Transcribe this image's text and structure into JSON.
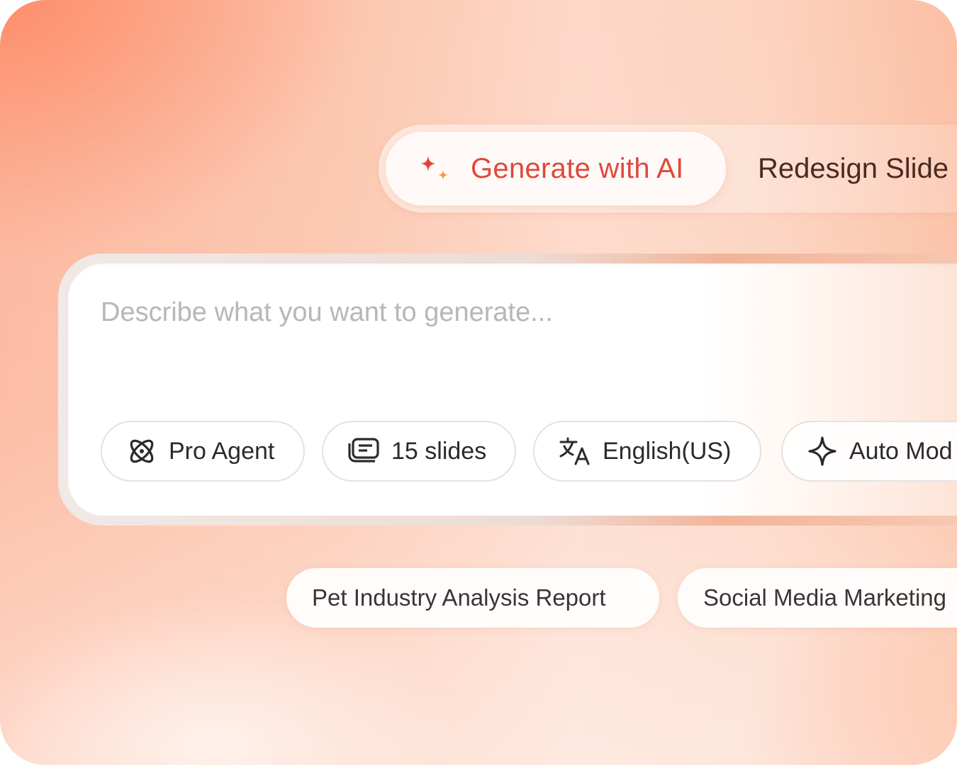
{
  "mode_switch": {
    "active_tab": {
      "label": "Generate with AI",
      "icon": "sparkle-icon",
      "color": "#e0483a"
    },
    "inactive_tab": {
      "label": "Redesign Slide"
    }
  },
  "prompt": {
    "placeholder": "Describe what you want to generate...",
    "value": ""
  },
  "options": [
    {
      "label": "Pro Agent",
      "icon": "atom-icon"
    },
    {
      "label": "15 slides",
      "icon": "slides-stack-icon"
    },
    {
      "label": "English(US)",
      "icon": "translate-icon"
    },
    {
      "label": "Auto Mod",
      "icon": "sparkle-outline-icon"
    }
  ],
  "suggestions": [
    {
      "label": "Pet Industry Analysis Report"
    },
    {
      "label": "Social Media Marketing"
    }
  ],
  "colors": {
    "accent": "#e0483a",
    "accent_secondary": "#f39a3c",
    "background_peach": "#fcc5ad"
  }
}
